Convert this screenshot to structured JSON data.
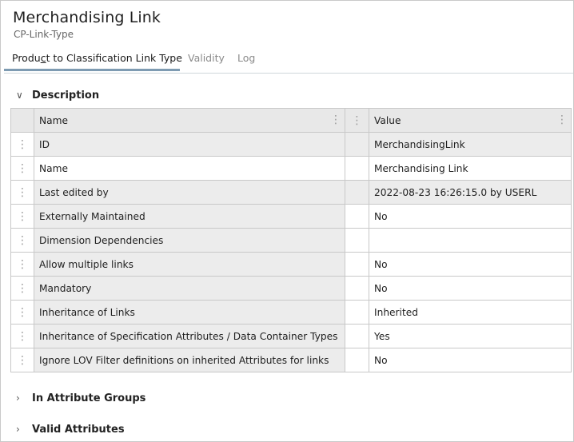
{
  "header": {
    "title": "Merchandising Link",
    "subtitle": "CP-Link-Type"
  },
  "tabs": [
    {
      "label": "Product to Classification Link Type",
      "active": true
    },
    {
      "label": "Validity",
      "active": false
    },
    {
      "label": "Log",
      "active": false
    }
  ],
  "sections": {
    "description": {
      "label": "Description",
      "expanded": true
    },
    "attribute_groups": {
      "label": "In Attribute Groups",
      "expanded": false
    },
    "valid_attributes": {
      "label": "Valid Attributes",
      "expanded": false
    }
  },
  "table": {
    "columns": {
      "name": "Name",
      "value": "Value"
    },
    "rows": [
      {
        "name": "ID",
        "value": "MerchandisingLink"
      },
      {
        "name": "Name",
        "value": "Merchandising Link"
      },
      {
        "name": "Last edited by",
        "value": "2022-08-23 16:26:15.0 by USERL"
      },
      {
        "name": "Externally Maintained",
        "value": "No"
      },
      {
        "name": "Dimension Dependencies",
        "value": ""
      },
      {
        "name": "Allow multiple links",
        "value": "No"
      },
      {
        "name": "Mandatory",
        "value": "No"
      },
      {
        "name": "Inheritance of Links",
        "value": "Inherited"
      },
      {
        "name": "Inheritance of Specification Attributes / Data Container Types",
        "value": "Yes"
      },
      {
        "name": "Ignore LOV Filter definitions on inherited Attributes for links",
        "value": "No"
      }
    ]
  },
  "icons": {
    "expanded": "chevron-down-icon",
    "collapsed": "chevron-right-icon",
    "row_menu": "vertical-dots-icon"
  },
  "colors": {
    "tab_underline": "#7e9bb2",
    "header_bg": "#e8e8e8",
    "shaded_cell": "#ececec"
  }
}
